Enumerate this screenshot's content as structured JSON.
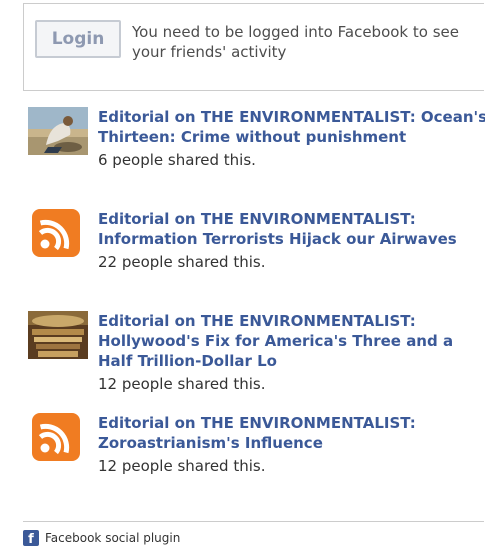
{
  "login": {
    "button_label": "Login",
    "message": "You need to be logged into Facebook to see your friends' activity"
  },
  "items": [
    {
      "title": "Editorial on THE ENVIRONMENTALIST: Ocean's Thirteen: Crime without punishment",
      "shared": "6 people shared this.",
      "thumb": "photo-man-beach"
    },
    {
      "title": "Editorial on THE ENVIRONMENTALIST: Information Terrorists Hijack our Airwaves",
      "shared": "22 people shared this.",
      "thumb": "rss-icon"
    },
    {
      "title": "Editorial on THE ENVIRONMENTALIST: Hollywood's Fix for America's Three and a Half Trillion-Dollar Lo",
      "shared": "12 people shared this.",
      "thumb": "photo-theater"
    },
    {
      "title": "Editorial on THE ENVIRONMENTALIST: Zoroastrianism's Influence",
      "shared": "12 people shared this.",
      "thumb": "rss-icon"
    }
  ],
  "footer": {
    "label": "Facebook social plugin",
    "logo_letter": "f"
  },
  "colors": {
    "link": "#3b5998",
    "rss": "#f07c22",
    "border": "#cccccc"
  }
}
